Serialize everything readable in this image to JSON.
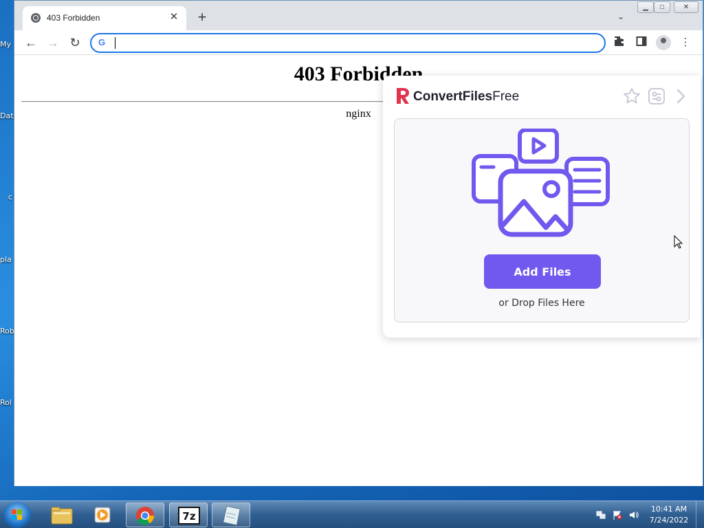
{
  "desktop": {
    "icons": [
      "My",
      "Dat",
      "c",
      "pla",
      "Rob",
      "Rol"
    ]
  },
  "browser": {
    "tab": {
      "title": "403 Forbidden",
      "close_glyph": "✕"
    },
    "new_tab_glyph": "+",
    "tab_search_glyph": "⌄",
    "window_controls": {
      "minimize": "▁",
      "maximize": "□",
      "close": "✕"
    },
    "nav": {
      "back": "←",
      "forward": "→",
      "reload": "↻"
    },
    "omnibox": {
      "value": "",
      "google_mark": "G"
    },
    "toolbar_icons": [
      "extensions-icon",
      "side-panel-icon",
      "profile-icon",
      "menu-icon"
    ],
    "menu_glyph": "⋮"
  },
  "page": {
    "title": "403 Forbidden",
    "server": "nginx"
  },
  "extension_popup": {
    "brand_bold": "ConvertFiles",
    "brand_light": "Free",
    "add_button": "Add Files",
    "drop_hint": "or Drop Files Here",
    "accent_color": "#7158ee",
    "logo_color": "#e0344f"
  },
  "taskbar": {
    "apps": [
      "windows-explorer",
      "media-player",
      "google-chrome",
      "7-zip",
      "notepad"
    ],
    "clock_time": "10:41 AM",
    "clock_date": "7/24/2022"
  }
}
